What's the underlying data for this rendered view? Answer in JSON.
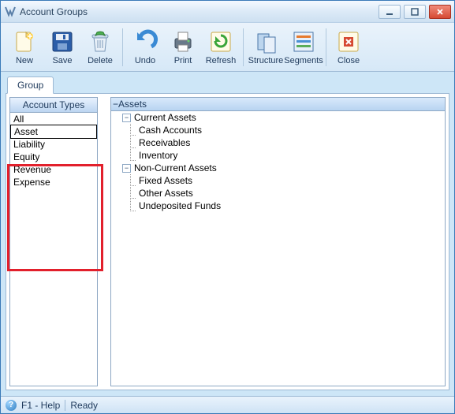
{
  "window": {
    "title": "Account Groups"
  },
  "toolbar": {
    "new": "New",
    "save": "Save",
    "delete": "Delete",
    "undo": "Undo",
    "print": "Print",
    "refresh": "Refresh",
    "structure": "Structure",
    "segments": "Segments",
    "close": "Close"
  },
  "tabs": {
    "group": "Group"
  },
  "sidebar": {
    "header": "Account Types",
    "items": [
      "All",
      "Asset",
      "Liability",
      "Equity",
      "Revenue",
      "Expense"
    ],
    "selected_index": 1
  },
  "tree": {
    "root": "Assets",
    "children": [
      {
        "label": "Current Assets",
        "children": [
          "Cash Accounts",
          "Receivables",
          "Inventory"
        ]
      },
      {
        "label": "Non-Current Assets",
        "children": [
          "Fixed Assets",
          "Other Assets",
          "Undeposited Funds"
        ]
      }
    ]
  },
  "status": {
    "help": "F1 - Help",
    "state": "Ready"
  }
}
